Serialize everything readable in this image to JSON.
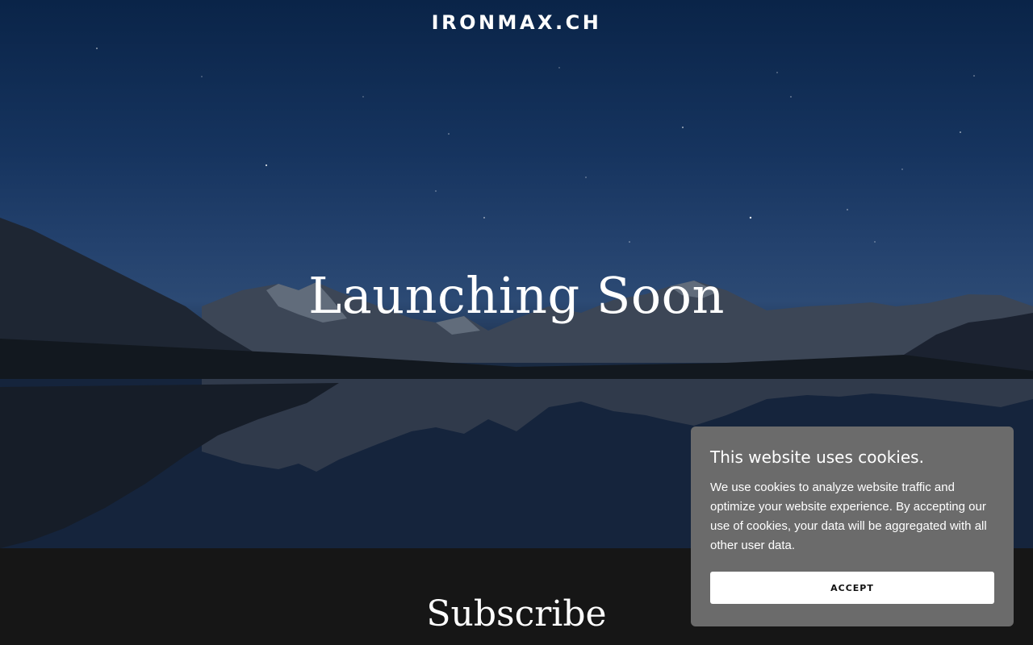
{
  "site": {
    "title": "IRONMAX.CH"
  },
  "hero": {
    "headline": "Launching Soon"
  },
  "subscribe": {
    "title": "Subscribe"
  },
  "cookie_banner": {
    "title": "This website uses cookies.",
    "text": "We use cookies to analyze website traffic and optimize your website experience. By accepting our use of cookies, your data will be aggregated with all other user data.",
    "accept_label": "ACCEPT"
  },
  "colors": {
    "sky_top": "#0a2448",
    "sky_horizon": "#2c4a74",
    "footer_bg": "#161616",
    "banner_bg": "#6b6b6b",
    "button_bg": "#ffffff"
  }
}
